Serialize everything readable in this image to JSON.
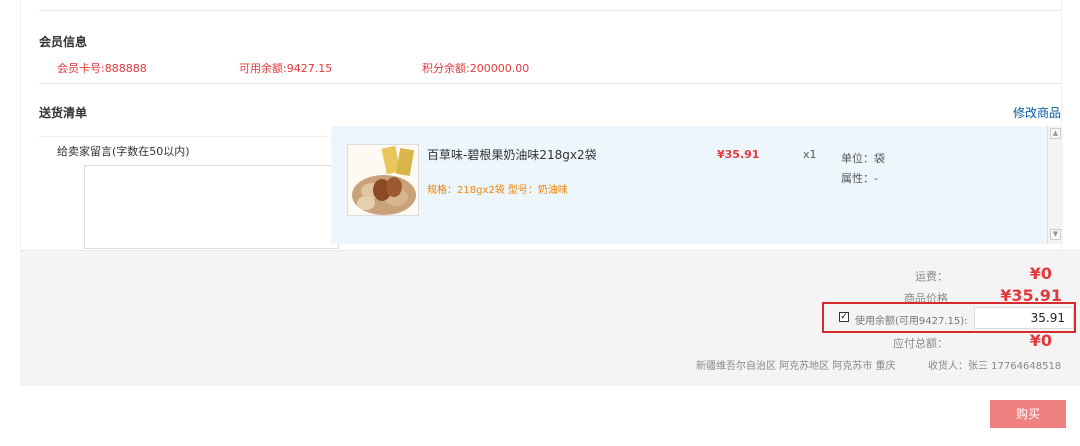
{
  "member": {
    "section_title": "会员信息",
    "card_no": "会员卡号:888888",
    "balance": "可用余额:9427.15",
    "points": "积分余额:200000.00"
  },
  "delivery": {
    "section_title": "送货清单",
    "edit_link": "修改商品",
    "note_label": "给卖家留言(字数在50以内)",
    "note_value": ""
  },
  "product": {
    "name": "百草味-碧根果奶油味218gx2袋",
    "spec": "规格：218gx2袋 型号：奶油味",
    "price": "¥35.91",
    "qty": "x1",
    "unit": "单位：袋",
    "attr": "属性：-"
  },
  "summary": {
    "shipping_label": "运费：",
    "shipping_value": "¥0",
    "goods_label": "商品价格",
    "goods_value": "¥35.91",
    "use_balance_label": "使用余额(可用9427.15):",
    "use_balance_checked": true,
    "use_balance_value": "35.91",
    "total_label": "应付总额：",
    "total_value": "¥0",
    "address": "新疆维吾尔自治区 阿克苏地区 阿克苏市 重庆",
    "receiver": "收货人：张三 17764648518"
  },
  "actions": {
    "buy_label": "购买"
  },
  "colors": {
    "accent_red": "#e4393c",
    "link_blue": "#005aa0",
    "spec_orange": "#f08300",
    "buy_button": "#f08080",
    "highlight_box": "#d62b2b"
  }
}
